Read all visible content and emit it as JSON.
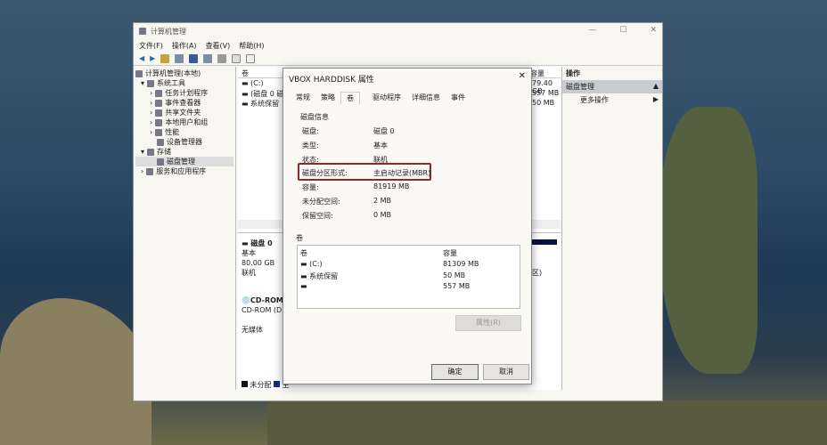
{
  "window": {
    "title": "计算机管理",
    "menu": [
      "文件(F)",
      "操作(A)",
      "查看(V)",
      "帮助(H)"
    ]
  },
  "tree": [
    {
      "label": "计算机管理(本地)",
      "level": 0
    },
    {
      "label": "系统工具",
      "level": 1
    },
    {
      "label": "任务计划程序",
      "level": 2
    },
    {
      "label": "事件查看器",
      "level": 2
    },
    {
      "label": "共享文件夹",
      "level": 2
    },
    {
      "label": "本地用户和组",
      "level": 2
    },
    {
      "label": "性能",
      "level": 2
    },
    {
      "label": "设备管理器",
      "level": 2
    },
    {
      "label": "存储",
      "level": 1
    },
    {
      "label": "磁盘管理",
      "level": 2
    },
    {
      "label": "服务和应用程序",
      "level": 1
    }
  ],
  "volumes": {
    "header": "卷",
    "header_cap": "容量",
    "items": [
      {
        "name": "(C:)",
        "cap": "79.40 GB"
      },
      {
        "name": "(磁盘 0 磁盘",
        "cap": "557 MB"
      },
      {
        "name": "系统保留",
        "cap": "50 MB"
      }
    ]
  },
  "disks": [
    {
      "name": "磁盘 0",
      "type": "基本",
      "size": "80.00 GB",
      "status": "联机"
    },
    {
      "name": "CD-ROM",
      "sub": "CD-ROM (D:)",
      "status": "无媒体"
    }
  ],
  "legend": {
    "unallocated": "未分配",
    "primary": "主"
  },
  "map_partial": "区)",
  "actions": {
    "title": "操作",
    "section": "磁盘管理",
    "more": "更多操作"
  },
  "dialog": {
    "title": "VBOX HARDDISK 属性",
    "tabs": [
      "常规",
      "策略",
      "卷",
      "驱动程序",
      "详细信息",
      "事件"
    ],
    "active_tab": "卷",
    "section_disk": "磁盘信息",
    "info": [
      {
        "k": "磁盘:",
        "v": "磁盘 0"
      },
      {
        "k": "类型:",
        "v": "基本"
      },
      {
        "k": "状态:",
        "v": "联机"
      },
      {
        "k": "磁盘分区形式:",
        "v": "主启动记录(MBR)"
      },
      {
        "k": "容量:",
        "v": "81919 MB"
      },
      {
        "k": "未分配空间:",
        "v": "2 MB"
      },
      {
        "k": "保留空间:",
        "v": "0 MB"
      }
    ],
    "section_vol": "卷",
    "vol_headers": [
      "卷",
      "容量"
    ],
    "vols": [
      {
        "name": "(C:)",
        "cap": "81309 MB"
      },
      {
        "name": "系统保留",
        "cap": "50 MB"
      },
      {
        "name": "",
        "cap": "557 MB"
      }
    ],
    "properties_btn": "属性(R)",
    "ok": "确定",
    "cancel": "取消"
  }
}
